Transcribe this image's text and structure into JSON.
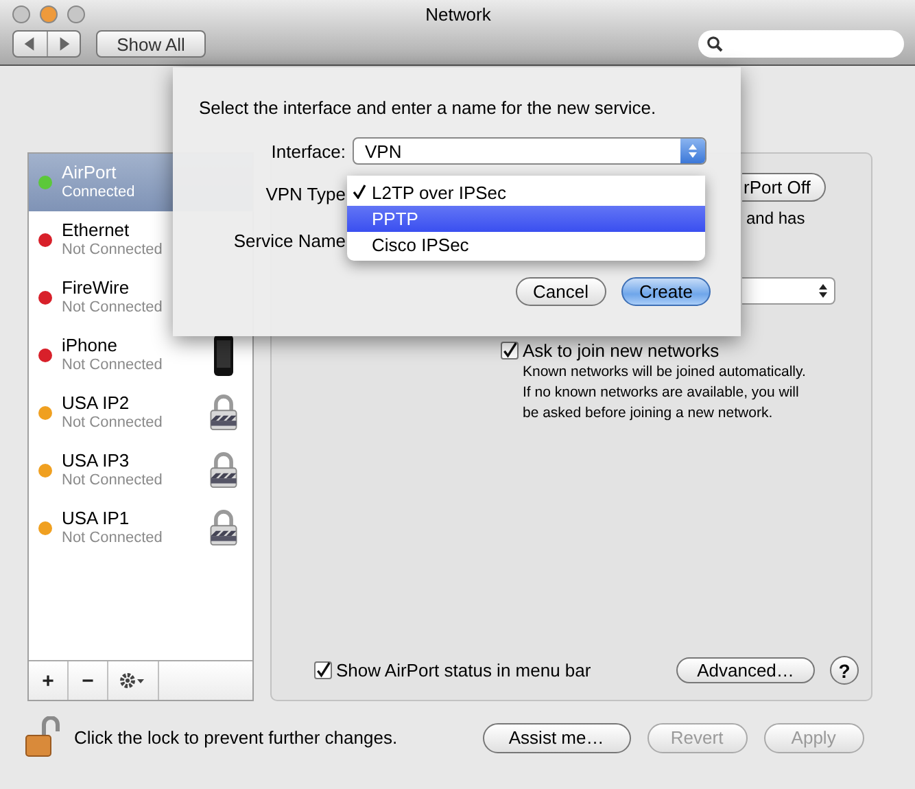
{
  "window": {
    "title": "Network",
    "traffic_lights": [
      {
        "color": "#c6c6c6"
      },
      {
        "color": "#ee9a3c"
      },
      {
        "color": "#c6c6c6"
      }
    ]
  },
  "toolbar": {
    "show_all": "Show All"
  },
  "services": [
    {
      "name": "AirPort",
      "status": "Connected",
      "color": "#5cc83a",
      "selected": true,
      "kind": "none"
    },
    {
      "name": "Ethernet",
      "status": "Not Connected",
      "color": "#d8202a",
      "selected": false,
      "kind": "none"
    },
    {
      "name": "FireWire",
      "status": "Not Connected",
      "color": "#d8202a",
      "selected": false,
      "kind": "none"
    },
    {
      "name": "iPhone",
      "status": "Not Connected",
      "color": "#d8202a",
      "selected": false,
      "kind": "phone"
    },
    {
      "name": "USA IP2",
      "status": "Not Connected",
      "color": "#f0a020",
      "selected": false,
      "kind": "lock"
    },
    {
      "name": "USA IP3",
      "status": "Not Connected",
      "color": "#f0a020",
      "selected": false,
      "kind": "lock"
    },
    {
      "name": "USA IP1",
      "status": "Not Connected",
      "color": "#f0a020",
      "selected": false,
      "kind": "lock"
    }
  ],
  "list_buttons": [
    "+",
    "−"
  ],
  "panel": {
    "power_button": "rPort Off",
    "status_fragment": "and has",
    "ask_to_join": {
      "label": "Ask to join new networks",
      "checked": true
    },
    "ask_note": "Known networks will be joined automatically.\nIf no known networks are available, you will\nbe asked before joining a new network.",
    "show_status": {
      "label": "Show AirPort status in menu bar",
      "checked": true
    },
    "advanced": "Advanced…",
    "help": "?"
  },
  "sheet": {
    "prompt": "Select the interface and enter a name for the new service.",
    "interface": {
      "label": "Interface:",
      "value": "VPN"
    },
    "vpn_type": {
      "label": "VPN Type",
      "options": [
        {
          "label": "L2TP over IPSec",
          "checked": true,
          "selected": false
        },
        {
          "label": "PPTP",
          "checked": false,
          "selected": true
        },
        {
          "label": "Cisco IPSec",
          "checked": false,
          "selected": false
        }
      ]
    },
    "service_name": {
      "label": "Service Name"
    },
    "buttons": [
      {
        "label": "Cancel",
        "default": false
      },
      {
        "label": "Create",
        "default": true
      }
    ]
  },
  "footer": {
    "lock_text": "Click the lock to prevent further changes.",
    "buttons": [
      {
        "label": "Assist me…",
        "disabled": false
      },
      {
        "label": "Revert",
        "disabled": true
      },
      {
        "label": "Apply",
        "disabled": true
      }
    ]
  }
}
